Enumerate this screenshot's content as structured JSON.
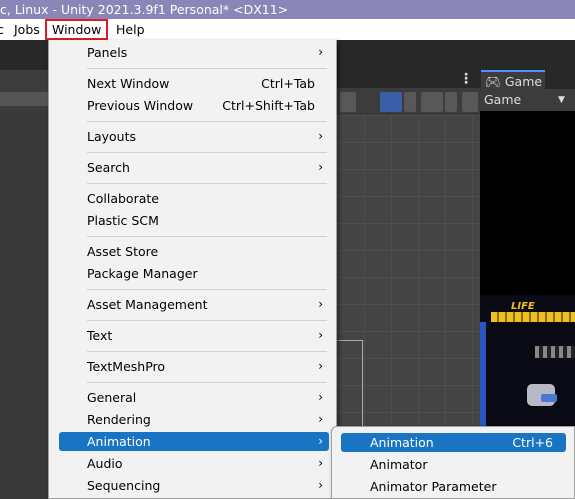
{
  "window_title": "c, Linux - Unity 2021.3.9f1 Personal* <DX11>",
  "menubar": {
    "clipped_prev": "c",
    "jobs": "Jobs",
    "window": "Window",
    "help": "Help"
  },
  "game_panel": {
    "tab_label": "Game",
    "display_label": "Game",
    "life_label": "LIFE"
  },
  "window_menu": {
    "items": [
      {
        "label": "Panels",
        "shortcut": "",
        "submenu": true
      },
      {
        "label": "Next Window",
        "shortcut": "Ctrl+Tab",
        "submenu": false
      },
      {
        "label": "Previous Window",
        "shortcut": "Ctrl+Shift+Tab",
        "submenu": false
      },
      {
        "label": "Layouts",
        "shortcut": "",
        "submenu": true
      },
      {
        "label": "Search",
        "shortcut": "",
        "submenu": true
      },
      {
        "label": "Collaborate",
        "shortcut": "",
        "submenu": false
      },
      {
        "label": "Plastic SCM",
        "shortcut": "",
        "submenu": false
      },
      {
        "label": "Asset Store",
        "shortcut": "",
        "submenu": false
      },
      {
        "label": "Package Manager",
        "shortcut": "",
        "submenu": false
      },
      {
        "label": "Asset Management",
        "shortcut": "",
        "submenu": true
      },
      {
        "label": "Text",
        "shortcut": "",
        "submenu": true
      },
      {
        "label": "TextMeshPro",
        "shortcut": "",
        "submenu": true
      },
      {
        "label": "General",
        "shortcut": "",
        "submenu": true
      },
      {
        "label": "Rendering",
        "shortcut": "",
        "submenu": true
      },
      {
        "label": "Animation",
        "shortcut": "",
        "submenu": true,
        "highlighted": true
      },
      {
        "label": "Audio",
        "shortcut": "",
        "submenu": true
      },
      {
        "label": "Sequencing",
        "shortcut": "",
        "submenu": true
      }
    ]
  },
  "animation_submenu": {
    "items": [
      {
        "label": "Animation",
        "shortcut": "Ctrl+6",
        "highlighted": true
      },
      {
        "label": "Animator",
        "shortcut": ""
      },
      {
        "label": "Animator Parameter",
        "shortcut": ""
      }
    ]
  },
  "submenu_arrow": "›",
  "colors": {
    "highlight": "#1a74c4",
    "window_menu_outline": "#e01b24",
    "title_bar": "#8a86b8"
  }
}
